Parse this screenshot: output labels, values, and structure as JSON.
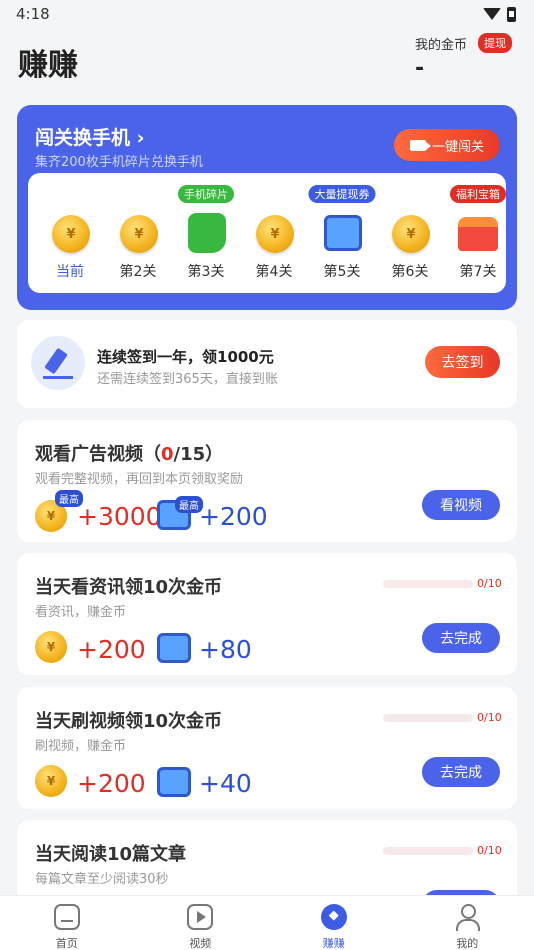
{
  "status_bar": {
    "time": "4:18"
  },
  "header": {
    "title": "赚赚",
    "coins_label": "我的金币",
    "withdraw": "提现",
    "coins_value": "-"
  },
  "level_card": {
    "title": "闯关换手机 ›",
    "subtitle": "集齐200枚手机碎片兑换手机",
    "button": "一键闯关",
    "levels": [
      {
        "label": "当前",
        "tag": "",
        "icon": "coin-icon"
      },
      {
        "label": "第2关",
        "tag": "",
        "icon": "coin-icon"
      },
      {
        "label": "第3关",
        "tag": "手机碎片",
        "icon": "puzzle-icon"
      },
      {
        "label": "第4关",
        "tag": "",
        "icon": "coin-icon"
      },
      {
        "label": "第5关",
        "tag": "大量提现券",
        "icon": "ticket-icon"
      },
      {
        "label": "第6关",
        "tag": "",
        "icon": "coin-icon"
      },
      {
        "label": "第7关",
        "tag": "福利宝箱",
        "icon": "chest-icon"
      }
    ],
    "colors": {
      "tag_green": "#39b83f",
      "tag_blue": "#3c5ce4",
      "tag_red": "#e02e24"
    }
  },
  "signin": {
    "title": "连续签到一年，领1000元",
    "subtitle": "还需连续签到365天，直接到账",
    "button": "去签到"
  },
  "tasks": [
    {
      "title_prefix": "观看广告视频（",
      "count": "0",
      "title_suffix": "/15）",
      "subtitle": "观看完整视频，再回到本页领取奖励",
      "coin_reward": "+3000",
      "ticket_reward": "+200",
      "coin_tag": "最高",
      "ticket_tag": "最高",
      "button": "看视频"
    },
    {
      "title": "当天看资讯领10次金币",
      "subtitle": "看资讯，赚金币",
      "coin_reward": "+200",
      "ticket_reward": "+80",
      "progress": "0/10",
      "progress_value": 0,
      "button": "去完成"
    },
    {
      "title": "当天刷视频领10次金币",
      "subtitle": "刷视频，赚金币",
      "coin_reward": "+200",
      "ticket_reward": "+40",
      "progress": "0/10",
      "progress_value": 0,
      "button": "去完成"
    },
    {
      "title": "当天阅读10篇文章",
      "subtitle": "每篇文章至少阅读30秒",
      "progress": "0/10",
      "progress_value": 0
    }
  ],
  "tab_bar": {
    "tabs": [
      "首页",
      "视频",
      "赚赚",
      "我的"
    ],
    "active": "赚赚"
  },
  "coin_symbol": "¥"
}
